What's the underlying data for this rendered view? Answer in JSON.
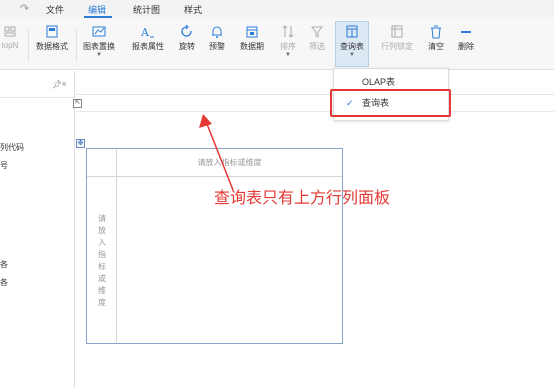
{
  "menubar": {
    "redo_icon": "redo-icon",
    "menus": [
      "文件",
      "编辑",
      "统计图",
      "样式"
    ],
    "active_menu": "编辑",
    "accent_color": "#2b7dd9"
  },
  "toolbar": {
    "topn_label": "topN",
    "data_format_label": "数据格式",
    "chart_replace_label": "图表置换",
    "report_props_label": "报表属性",
    "rotate_label": "旋转",
    "warning_label": "预警",
    "data_period_label": "数据期",
    "sort_label": "排序",
    "filter_label": "筛选",
    "query_table_label": "查询表",
    "freeze_label": "行列锁定",
    "clear_label": "清空",
    "delete_label": "删除"
  },
  "left_panel": {
    "pin_icon": "pin-icon",
    "collapse_icon": "double-chevron-left-icon",
    "items": [
      "列代码",
      "号",
      "各",
      "各"
    ]
  },
  "canvas": {
    "expand_icon": "expand-icon",
    "move_icon": "move-handle-icon",
    "col_placeholder": "请放入指标或维度",
    "row_placeholder": "请放入指标或维度"
  },
  "dropdown": {
    "options": [
      "OLAP表",
      "查询表"
    ],
    "selected": "查询表",
    "check_icon": "check-icon"
  },
  "annotation": {
    "text": "查询表只有上方行列面板",
    "color": "#e53935"
  }
}
